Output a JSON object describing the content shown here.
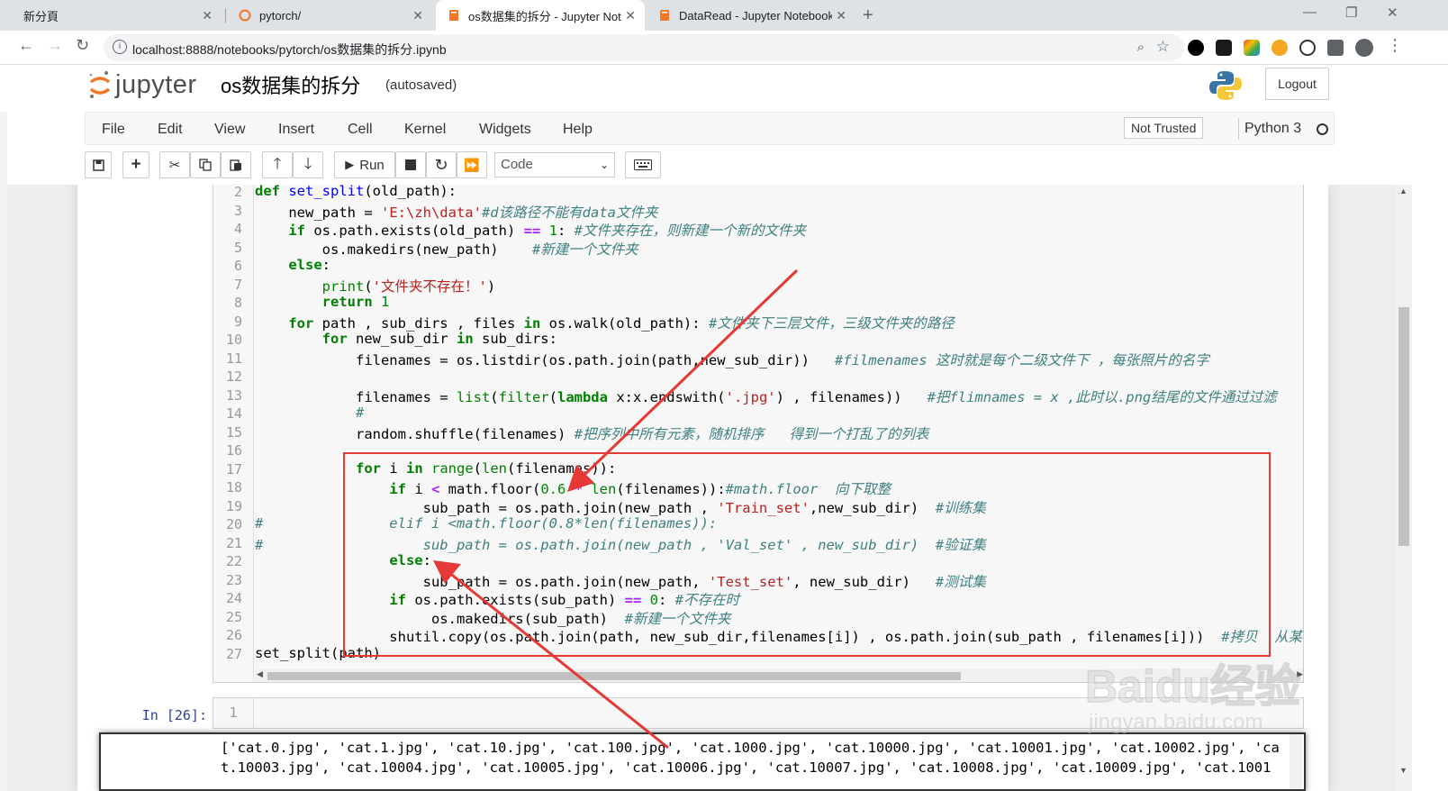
{
  "browser": {
    "tabs": [
      {
        "title": "新分頁",
        "active": false
      },
      {
        "title": "pytorch/",
        "active": false
      },
      {
        "title": "os数据集的拆分 - Jupyter Notel",
        "active": true
      },
      {
        "title": "DataRead - Jupyter Notebook",
        "active": false
      }
    ],
    "close_glyph": "✕",
    "new_tab_glyph": "+",
    "url": "localhost:8888/notebooks/pytorch/os数据集的拆分.ipynb",
    "window_controls": {
      "minimize": "—",
      "maximize": "❐",
      "close": "✕"
    }
  },
  "jupyter": {
    "logo_text": "jupyter",
    "notebook_title": "os数据集的拆分",
    "autosave_status": "(autosaved)",
    "logout_label": "Logout",
    "menu": [
      "File",
      "Edit",
      "View",
      "Insert",
      "Cell",
      "Kernel",
      "Widgets",
      "Help"
    ],
    "trust_status": "Not Trusted",
    "kernel_name": "Python 3",
    "toolbar": {
      "run_label": "Run",
      "cell_type": "Code"
    },
    "colors": {
      "brand_orange": "#f37726",
      "prompt_blue": "#303f9f",
      "annotation_red": "#e53935"
    }
  },
  "code_cell": {
    "line_numbers": [
      "2",
      "3",
      "4",
      "5",
      "6",
      "7",
      "8",
      "9",
      "10",
      "11",
      "12",
      "13",
      "14",
      "15",
      "16",
      "17",
      "18",
      "19",
      "20",
      "21",
      "22",
      "23",
      "24",
      "25",
      "26",
      "27"
    ],
    "lines": [
      "def set_split(old_path):",
      "    new_path = 'E:\\zh\\data'#d该路径不能有data文件夹",
      "    if os.path.exists(old_path) == 1: #文件夹存在，则新建一个新的文件夹",
      "        os.makedirs(new_path)    #新建一个文件夹",
      "    else:",
      "        print('文件夹不存在！')",
      "        return 1",
      "    for path , sub_dirs , files in os.walk(old_path): #文件夹下三层文件，三级文件夹的路径",
      "        for new_sub_dir in sub_dirs:",
      "            filenames = os.listdir(os.path.join(path,new_sub_dir))   #filmenames 这时就是每个二级文件下 ，每张照片的名字",
      "",
      "            filenames = list(filter(lambda x:x.endswith('.jpg') , filenames))   #把flimnames = x ,此时以.png结尾的文件通过过滤",
      "            #",
      "            random.shuffle(filenames) #把序列中所有元素，随机排序   得到一个打乱了的列表",
      "",
      "            for i in range(len(filenames)):",
      "                if i < math.floor(0.6 * len(filenames)):#math.floor  向下取整",
      "                    sub_path = os.path.join(new_path , 'Train_set',new_sub_dir)  #训练集",
      "#               elif i <math.floor(0.8*len(filenames)):",
      "#                   sub_path = os.path.join(new_path , 'Val_set' , new_sub_dir)  #验证集",
      "                else:",
      "                    sub_path = os.path.join(new_path, 'Test_set', new_sub_dir)   #测试集",
      "                if os.path.exists(sub_path) == 0: #不存在时",
      "                     os.makedirs(sub_path)  #新建一个文件夹",
      "                shutil.copy(os.path.join(path, new_sub_dir,filenames[i]) , os.path.join(sub_path , filenames[i]))  #拷贝  从某",
      "set_split(path)"
    ]
  },
  "second_cell": {
    "prompt": "In [26]:",
    "line_number": "1"
  },
  "output": {
    "line1": "['cat.0.jpg', 'cat.1.jpg', 'cat.10.jpg', 'cat.100.jpg', 'cat.1000.jpg', 'cat.10000.jpg', 'cat.10001.jpg', 'cat.10002.jpg', 'ca",
    "line2": "t.10003.jpg', 'cat.10004.jpg', 'cat.10005.jpg', 'cat.10006.jpg', 'cat.10007.jpg', 'cat.10008.jpg', 'cat.10009.jpg', 'cat.1001"
  },
  "watermark": {
    "main": "Baidu经验",
    "sub": "jingyan.baidu.com"
  }
}
